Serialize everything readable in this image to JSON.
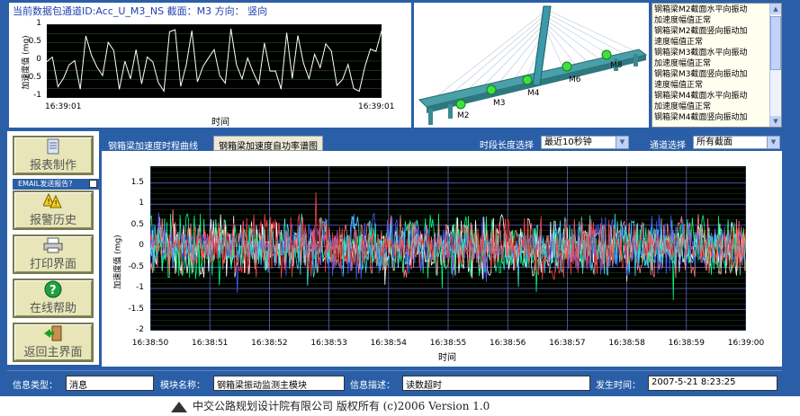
{
  "top": {
    "channel_label": "当前数据包通道ID:Acc_U_M3_NS 截面：M3 方向： 竖向",
    "mini_chart": {
      "ylabel": "加速度值 (mg)",
      "yticks": [
        "1",
        "0.5",
        "0",
        "-0.5",
        "-1"
      ],
      "x_start": "16:39:01",
      "x_end": "16:39:01",
      "xlabel": "时间"
    },
    "bridge_labels": [
      "M2",
      "M3",
      "M4",
      "M6",
      "M8"
    ],
    "messages": [
      "钢箱梁M2截面水平向振动",
      "加速度幅值正常",
      "钢箱梁M2截面竖向振动加",
      "速度幅值正常",
      "钢箱梁M3截面水平向振动",
      "加速度幅值正常",
      "钢箱梁M3截面竖向振动加",
      "速度幅值正常",
      "钢箱梁M4截面水平向振动",
      "加速度幅值正常",
      "钢箱梁M4截面竖向振动加"
    ]
  },
  "sidebar": {
    "report_button": "报表制作",
    "email_label": "EMAIL发送报告?",
    "alarm_button": "报警历史",
    "print_button": "打印界面",
    "help_button": "在线帮助",
    "home_button": "返回主界面"
  },
  "tabs": {
    "tab1": "钢箱梁加速度时程曲线",
    "tab2": "钢箱梁加速度自功率谱图"
  },
  "controls": {
    "period_label": "时段长度选择",
    "period_value": "最近10秒钟",
    "channel_label": "通道选择",
    "channel_value": "所有截面"
  },
  "chart_data": {
    "type": "line",
    "ylabel": "加速度值 (mg)",
    "xlabel": "时间",
    "yticks": [
      "1.5",
      "1",
      "0.5",
      "0",
      "-0.5",
      "-1",
      "-1.5",
      "-2"
    ],
    "ylim": [
      -2,
      1.9
    ],
    "categories": [
      "16:38:50",
      "16:38:51",
      "16:38:52",
      "16:38:53",
      "16:38:54",
      "16:38:55",
      "16:38:56",
      "16:38:57",
      "16:38:58",
      "16:38:59",
      "16:39:00"
    ],
    "series_colors": [
      "#ffffff",
      "#00ff80",
      "#ff8080",
      "#4060ff",
      "#40e0e0",
      "#ff4040"
    ],
    "grid": true
  },
  "status": {
    "type_label": "信息类型：",
    "type_value": "消息",
    "module_label": "模块名称：",
    "module_value": "钢箱梁振动监测主模块",
    "desc_label": "信息描述：",
    "desc_value": "读数超时",
    "time_label": "发生时间：",
    "time_value": "2007-5-21 8:23:25"
  },
  "footer": {
    "copyright": "中交公路规划设计院有限公司 版权所有 (c)2006 Version 1.0"
  }
}
